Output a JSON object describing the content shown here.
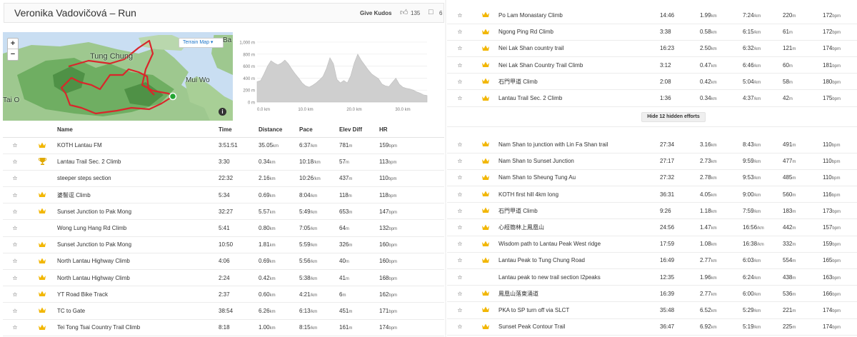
{
  "title": "Veronika Vadovičová – Run",
  "kudos": {
    "label": "Give Kudos",
    "count": "135",
    "comments": "6"
  },
  "map": {
    "terrain_label": "Terrain Map",
    "zoom_in": "+",
    "zoom_out": "−",
    "info": "i",
    "labels": {
      "tung_chung": "Tung Chung",
      "mui_wo": "Mui Wo",
      "tai_o": "Tai O",
      "ba": "Ba"
    },
    "route_color": "#d9262b",
    "end_color": "#22a532"
  },
  "elevation": {
    "y_ticks": [
      "1,000 m",
      "800 m",
      "600 m",
      "400 m",
      "200 m",
      "0 m"
    ],
    "x_ticks": [
      "0.0 km",
      "10.0 km",
      "20.0 km",
      "30.0 km"
    ],
    "profile_m": [
      340,
      360,
      470,
      600,
      690,
      650,
      620,
      650,
      700,
      640,
      550,
      470,
      400,
      320,
      270,
      250,
      280,
      320,
      370,
      430,
      560,
      740,
      640,
      380,
      320,
      360,
      320,
      440,
      650,
      800,
      700,
      620,
      540,
      470,
      430,
      390,
      300,
      270,
      260,
      330,
      400,
      300,
      250,
      230,
      220,
      200,
      170,
      150,
      120,
      110
    ],
    "ylim": [
      0,
      1000
    ]
  },
  "columns": {
    "name": "Name",
    "time": "Time",
    "distance": "Distance",
    "pace": "Pace",
    "elev": "Elev Diff",
    "hr": "HR"
  },
  "units": {
    "km": "km",
    "pace": "/km",
    "m": "m",
    "bpm": "bpm"
  },
  "hide_label": "Hide 12 hidden efforts",
  "left_rows": [
    {
      "icon": "crown",
      "name": "KOTH Lantau FM",
      "time": "3:51:51",
      "dist": "35.05",
      "pace": "6:37",
      "elev": "781",
      "hr": "159"
    },
    {
      "icon": "trophy",
      "name": "Lantau Trail Sec. 2 Climb",
      "time": "3:30",
      "dist": "0.34",
      "pace": "10:18",
      "elev": "57",
      "hr": "113"
    },
    {
      "icon": "",
      "name": "steeper steps section",
      "time": "22:32",
      "dist": "2.16",
      "pace": "10:26",
      "elev": "437",
      "hr": "110"
    },
    {
      "icon": "crown",
      "name": "婆髻逕 Climb",
      "time": "5:34",
      "dist": "0.69",
      "pace": "8:04",
      "elev": "118",
      "hr": "118"
    },
    {
      "icon": "crown",
      "name": "Sunset Junction to Pak Mong",
      "time": "32:27",
      "dist": "5.57",
      "pace": "5:49",
      "elev": "653",
      "hr": "147"
    },
    {
      "icon": "",
      "name": "Wong Lung Hang Rd Climb",
      "time": "5:41",
      "dist": "0.80",
      "pace": "7:05",
      "elev": "64",
      "hr": "132"
    },
    {
      "icon": "crown",
      "name": "Sunset Junction to Pak Mong",
      "time": "10:50",
      "dist": "1.81",
      "pace": "5:59",
      "elev": "326",
      "hr": "160"
    },
    {
      "icon": "crown",
      "name": "North Lantau Highway Climb",
      "time": "4:06",
      "dist": "0.69",
      "pace": "5:56",
      "elev": "40",
      "hr": "160"
    },
    {
      "icon": "crown",
      "name": "North Lantau Highway Climb",
      "time": "2:24",
      "dist": "0.42",
      "pace": "5:38",
      "elev": "41",
      "hr": "168"
    },
    {
      "icon": "crown",
      "name": "YT Road Bike Track",
      "time": "2:37",
      "dist": "0.60",
      "pace": "4:21",
      "elev": "6",
      "hr": "162"
    },
    {
      "icon": "crown",
      "name": "TC to Gate",
      "time": "38:54",
      "dist": "6.26",
      "pace": "6:13",
      "elev": "451",
      "hr": "171"
    },
    {
      "icon": "crown",
      "name": "Tei Tong Tsai Country Trail Climb",
      "time": "8:18",
      "dist": "1.00",
      "pace": "8:15",
      "elev": "161",
      "hr": "174"
    }
  ],
  "right_rows_top": [
    {
      "icon": "crown",
      "name": "Po Lam Monastary Climb",
      "time": "14:46",
      "dist": "1.99",
      "pace": "7:24",
      "elev": "220",
      "hr": "172"
    },
    {
      "icon": "crown",
      "name": "Ngong Ping Rd Climb",
      "time": "3:38",
      "dist": "0.58",
      "pace": "6:15",
      "elev": "61",
      "hr": "172"
    },
    {
      "icon": "crown",
      "name": "Nei Lak Shan country trail",
      "time": "16:23",
      "dist": "2.50",
      "pace": "6:32",
      "elev": "121",
      "hr": "174"
    },
    {
      "icon": "crown",
      "name": "Nei Lak Shan Country Trail Climb",
      "time": "3:12",
      "dist": "0.47",
      "pace": "6:46",
      "elev": "60",
      "hr": "181"
    },
    {
      "icon": "crown",
      "name": "石門甲道 Climb",
      "time": "2:08",
      "dist": "0.42",
      "pace": "5:04",
      "elev": "58",
      "hr": "180"
    },
    {
      "icon": "crown",
      "name": "Lantau Trail Sec. 2 Climb",
      "time": "1:36",
      "dist": "0.34",
      "pace": "4:37",
      "elev": "42",
      "hr": "175"
    }
  ],
  "right_rows_bottom": [
    {
      "icon": "crown",
      "name": "Nam Shan to junction with Lin Fa Shan trail",
      "time": "27:34",
      "dist": "3.16",
      "pace": "8:43",
      "elev": "491",
      "hr": "110"
    },
    {
      "icon": "crown",
      "name": "Nam Shan to Sunset Junction",
      "time": "27:17",
      "dist": "2.73",
      "pace": "9:59",
      "elev": "477",
      "hr": "110"
    },
    {
      "icon": "crown",
      "name": "Nam Shan to Sheung Tung Au",
      "time": "27:32",
      "dist": "2.78",
      "pace": "9:53",
      "elev": "485",
      "hr": "110"
    },
    {
      "icon": "crown",
      "name": "KOTH first hill 4km long",
      "time": "36:31",
      "dist": "4.05",
      "pace": "9:00",
      "elev": "560",
      "hr": "116"
    },
    {
      "icon": "crown",
      "name": "石門甲道 Climb",
      "time": "9:26",
      "dist": "1.18",
      "pace": "7:59",
      "elev": "183",
      "hr": "173"
    },
    {
      "icon": "crown",
      "name": "心經簡林上鳳凰山",
      "time": "24:56",
      "dist": "1.47",
      "pace": "16:56",
      "elev": "442",
      "hr": "157"
    },
    {
      "icon": "crown",
      "name": "Wisdom path to Lantau Peak West ridge",
      "time": "17:59",
      "dist": "1.08",
      "pace": "16:38",
      "elev": "332",
      "hr": "159"
    },
    {
      "icon": "crown",
      "name": "Lantau Peak to Tung Chung Road",
      "time": "16:49",
      "dist": "2.77",
      "pace": "6:03",
      "elev": "554",
      "hr": "165"
    },
    {
      "icon": "",
      "name": "Lantau peak to new trail section I2peaks",
      "time": "12:35",
      "dist": "1.96",
      "pace": "6:24",
      "elev": "438",
      "hr": "163"
    },
    {
      "icon": "crown",
      "name": "鳳凰山落東涌道",
      "time": "16:39",
      "dist": "2.77",
      "pace": "6:00",
      "elev": "536",
      "hr": "166"
    },
    {
      "icon": "crown",
      "name": "PKA to SP turn off via SLCT",
      "time": "35:48",
      "dist": "6.52",
      "pace": "5:29",
      "elev": "221",
      "hr": "174"
    },
    {
      "icon": "crown",
      "name": "Sunset Peak Contour Trail",
      "time": "36:47",
      "dist": "6.92",
      "pace": "5:19",
      "elev": "225",
      "hr": "174"
    }
  ],
  "colors": {
    "crown": "#f2b705",
    "trophy": "#e0a800",
    "star": "#aaaaaa"
  }
}
